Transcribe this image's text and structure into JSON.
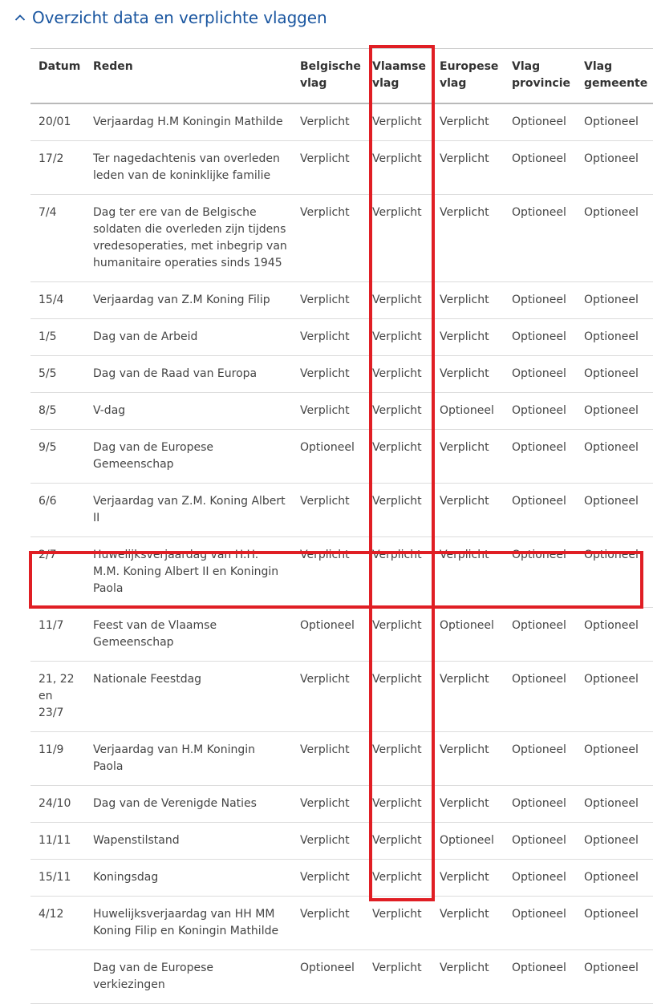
{
  "section": {
    "title": "Overzicht data en verplichte vlaggen",
    "chevron_icon": "chevron-up-icon",
    "title_color": "#1a56a0"
  },
  "highlight_color": "#e01e24",
  "table": {
    "headers": [
      "Datum",
      "Reden",
      "Belgische vlag",
      "Vlaamse vlag",
      "Europese vlag",
      "Vlag provincie",
      "Vlag gemeente"
    ],
    "rows": [
      [
        "20/01",
        "Verjaardag H.M Koningin Mathilde",
        "Verplicht",
        "Verplicht",
        "Verplicht",
        "Optioneel",
        "Optioneel"
      ],
      [
        "17/2",
        "Ter nagedachtenis van overleden leden van de koninklijke familie",
        "Verplicht",
        "Verplicht",
        "Verplicht",
        "Optioneel",
        "Optioneel"
      ],
      [
        "7/4",
        "Dag ter ere van de Belgische soldaten die overleden zijn tijdens vredesoperaties, met inbegrip van humanitaire operaties sinds 1945",
        "Verplicht",
        "Verplicht",
        "Verplicht",
        "Optioneel",
        "Optioneel"
      ],
      [
        "15/4",
        "Verjaardag van Z.M Koning Filip",
        "Verplicht",
        "Verplicht",
        "Verplicht",
        "Optioneel",
        "Optioneel"
      ],
      [
        "1/5",
        "Dag van de Arbeid",
        "Verplicht",
        "Verplicht",
        "Verplicht",
        "Optioneel",
        "Optioneel"
      ],
      [
        "5/5",
        "Dag van de Raad van Europa",
        "Verplicht",
        "Verplicht",
        "Verplicht",
        "Optioneel",
        "Optioneel"
      ],
      [
        "8/5",
        "V-dag",
        "Verplicht",
        "Verplicht",
        "Optioneel",
        "Optioneel",
        "Optioneel"
      ],
      [
        "9/5",
        "Dag van de Europese Gemeenschap",
        "Optioneel",
        "Verplicht",
        "Verplicht",
        "Optioneel",
        "Optioneel"
      ],
      [
        "6/6",
        "Verjaardag van Z.M. Koning Albert II",
        "Verplicht",
        "Verplicht",
        "Verplicht",
        "Optioneel",
        "Optioneel"
      ],
      [
        "2/7",
        "Huwelijksverjaardag van H.H. M.M. Koning Albert II en Koningin Paola",
        "Verplicht",
        "Verplicht",
        "Verplicht",
        "Optioneel",
        "Optioneel"
      ],
      [
        "11/7",
        "Feest van de Vlaamse Gemeenschap",
        "Optioneel",
        "Verplicht",
        "Optioneel",
        "Optioneel",
        "Optioneel"
      ],
      [
        "21, 22 en 23/7",
        "Nationale Feestdag",
        "Verplicht",
        "Verplicht",
        "Verplicht",
        "Optioneel",
        "Optioneel"
      ],
      [
        "11/9",
        "Verjaardag van H.M Koningin Paola",
        "Verplicht",
        "Verplicht",
        "Verplicht",
        "Optioneel",
        "Optioneel"
      ],
      [
        "24/10",
        "Dag van de Verenigde Naties",
        "Verplicht",
        "Verplicht",
        "Verplicht",
        "Optioneel",
        "Optioneel"
      ],
      [
        "11/11",
        "Wapenstilstand",
        "Verplicht",
        "Verplicht",
        "Optioneel",
        "Optioneel",
        "Optioneel"
      ],
      [
        "15/11",
        "Koningsdag",
        "Verplicht",
        "Verplicht",
        "Verplicht",
        "Optioneel",
        "Optioneel"
      ],
      [
        "4/12",
        "Huwelijksverjaardag van HH MM Koning Filip en Koningin Mathilde",
        "Verplicht",
        "Verplicht",
        "Verplicht",
        "Optioneel",
        "Optioneel"
      ],
      [
        "",
        "Dag van de Europese verkiezingen",
        "Optioneel",
        "Verplicht",
        "Verplicht",
        "Optioneel",
        "Optioneel"
      ]
    ]
  }
}
